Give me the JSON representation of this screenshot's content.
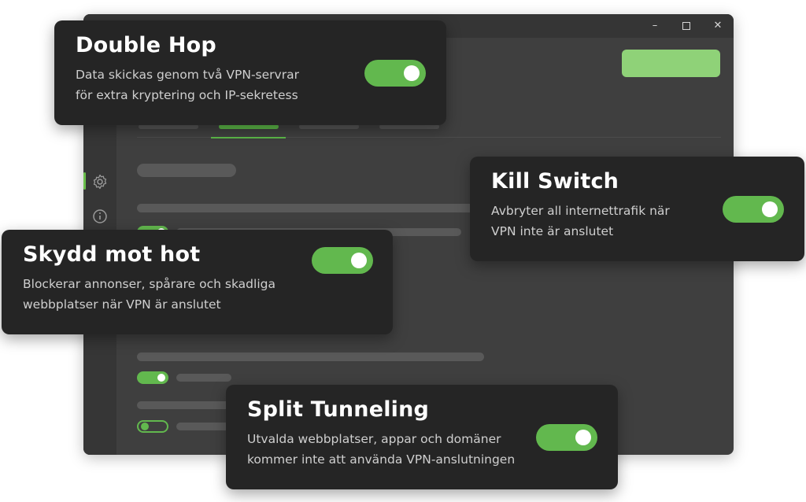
{
  "window": {
    "controls": {
      "minimize": "–",
      "close": "✕"
    }
  },
  "features": {
    "double_hop": {
      "title": "Double Hop",
      "line1": "Data skickas genom två VPN-servrar",
      "line2": "för extra kryptering och IP-sekretess",
      "enabled": true
    },
    "kill_switch": {
      "title": "Kill Switch",
      "line1": "Avbryter all internettrafik när",
      "line2": "VPN inte är anslutet",
      "enabled": true
    },
    "threat_protection": {
      "title": "Skydd mot hot",
      "line1": "Blockerar annonser, spårare och skadliga",
      "line2": "webbplatser när VPN är anslutet",
      "enabled": true
    },
    "split_tunneling": {
      "title": "Split Tunneling",
      "line1": "Utvalda webbplatser, appar och domäner",
      "line2": "kommer inte att använda VPN-anslutningen",
      "enabled": true
    }
  },
  "icons": {
    "sidebar": [
      "settings-icon",
      "info-icon",
      "user-icon"
    ]
  },
  "colors": {
    "accent": "#62b84e",
    "card_bg": "#252525",
    "window_bg": "#3f3f3f"
  }
}
